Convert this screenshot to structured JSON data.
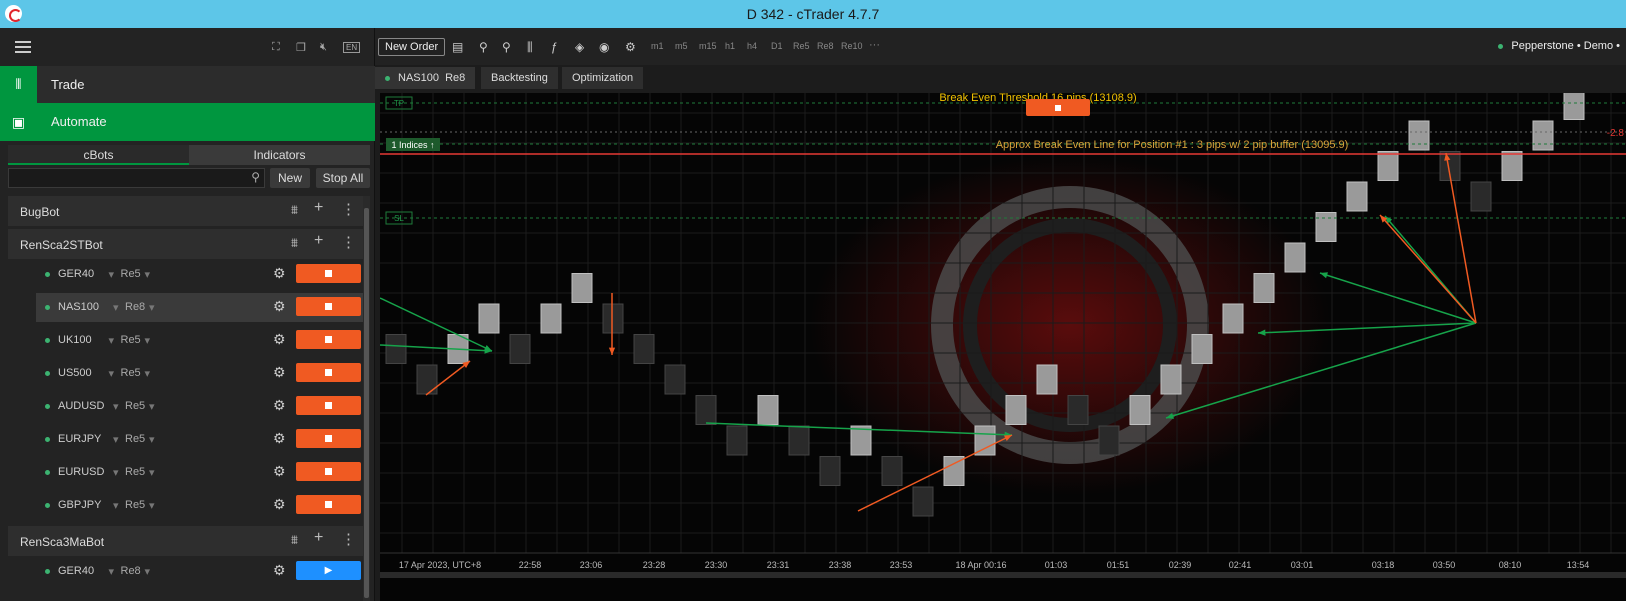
{
  "window": {
    "title": "D 342 - cTrader 4.7.7"
  },
  "sidebar": {
    "top_icons": [
      "fullscreen-icon",
      "window-icon",
      "mute-icon",
      "language-icon"
    ],
    "language": "EN",
    "modes": [
      {
        "label": "Trade"
      },
      {
        "label": "Automate"
      }
    ],
    "tabs": [
      "cBots",
      "Indicators"
    ],
    "search_placeholder": "",
    "new_label": "New",
    "stop_all_label": "Stop All",
    "groups": [
      {
        "name": "BugBot",
        "instances": []
      },
      {
        "name": "RenSca2STBot",
        "instances": [
          {
            "symbol": "GER40",
            "tf": "Re5",
            "state": "running"
          },
          {
            "symbol": "NAS100",
            "tf": "Re8",
            "state": "running",
            "selected": true
          },
          {
            "symbol": "UK100",
            "tf": "Re5",
            "state": "running"
          },
          {
            "symbol": "US500",
            "tf": "Re5",
            "state": "running"
          },
          {
            "symbol": "AUDUSD",
            "tf": "Re5",
            "state": "running"
          },
          {
            "symbol": "EURJPY",
            "tf": "Re5",
            "state": "running"
          },
          {
            "symbol": "EURUSD",
            "tf": "Re5",
            "state": "running"
          },
          {
            "symbol": "GBPJPY",
            "tf": "Re5",
            "state": "running"
          }
        ]
      },
      {
        "name": "RenSca3MaBot",
        "instances": [
          {
            "symbol": "GER40",
            "tf": "Re8",
            "state": "stopped"
          }
        ]
      }
    ]
  },
  "toolbar": {
    "new_order": "New Order",
    "timeframes": [
      "m1",
      "m5",
      "m15",
      "h1",
      "h4",
      "D1",
      "Re5",
      "Re8",
      "Re10"
    ],
    "more": "···",
    "broker": "Pepperstone • Demo •"
  },
  "chart_tabs": [
    {
      "symbol": "NAS100",
      "tf": "Re8"
    },
    {
      "label": "Backtesting"
    },
    {
      "label": "Optimization"
    }
  ],
  "chart": {
    "tp_label": "TP",
    "sl_label": "SL",
    "position_label": "1 Indices ↑",
    "break_even_threshold": "Break Even Threshold 16 pips (13108.9)",
    "approx_break_even": "Approx Break Even Line for Position #1 : 3 pips w/ 2 pip buffer  (13095.9)",
    "right_value": "-2.8",
    "colors": {
      "up_brick": "#9a9a9a",
      "down_brick": "#2a2a2a",
      "buy_arrow": "#16a34a",
      "sell_arrow": "#f05a22",
      "be_line": "#e53935",
      "tp_sl_line": "#1f7a3a",
      "text_yellow": "#f2c200"
    },
    "time_labels": [
      "17 Apr 2023, UTC+8",
      "22:58",
      "23:06",
      "23:28",
      "23:30",
      "23:31",
      "23:38",
      "23:53",
      "18 Apr 00:16",
      "01:03",
      "01:51",
      "02:39",
      "02:41",
      "03:01",
      "03:18",
      "03:50",
      "08:10",
      "13:54"
    ]
  }
}
